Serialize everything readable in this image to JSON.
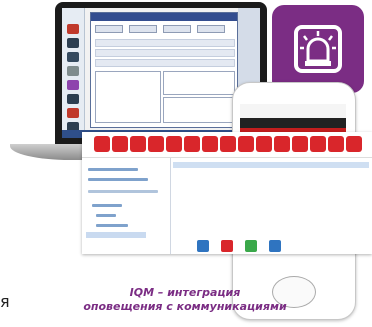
{
  "caption": {
    "line1": "IQM – интеграция",
    "line2": "оповещения с коммуникациями"
  },
  "left_text": "я",
  "colors": {
    "accent_purple": "#7b2d84",
    "alert_red": "#d9262b",
    "tree_blue": "#7fa2cc"
  },
  "icons": {
    "tile_icon": "alarm-siren-icon",
    "toolbar_icon": "red-toolbar-button-icon"
  }
}
